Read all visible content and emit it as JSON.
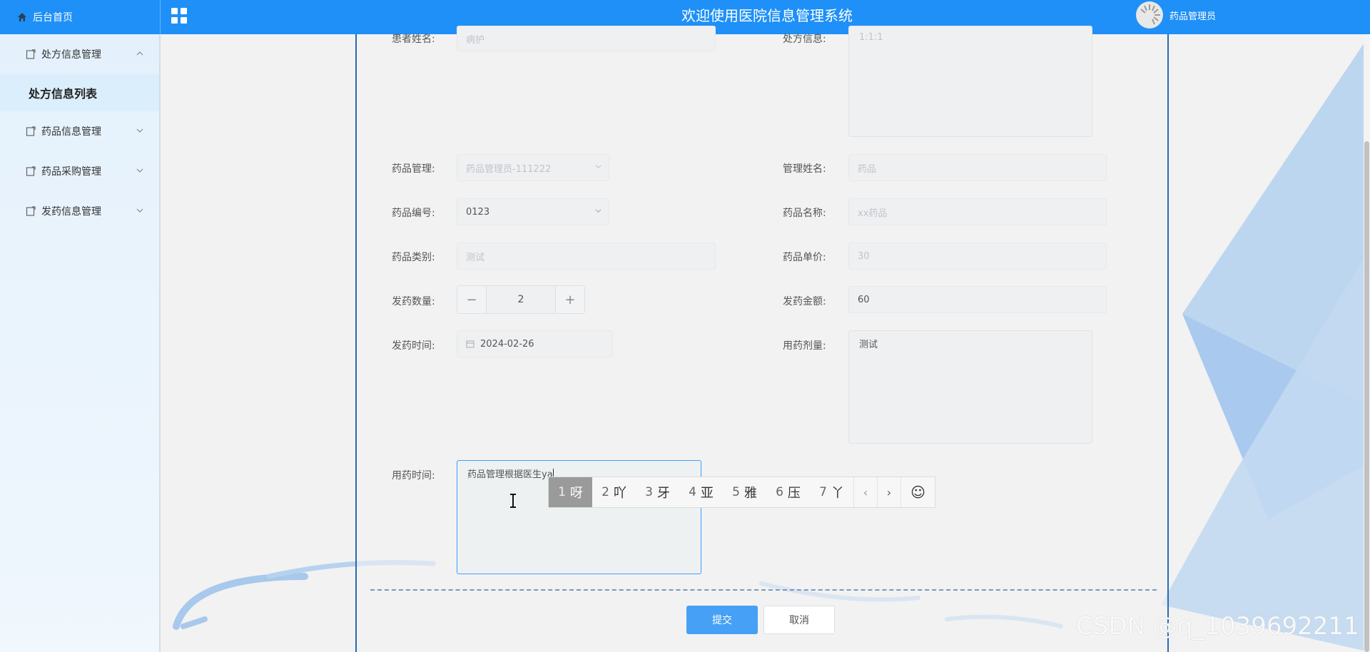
{
  "header": {
    "home_label": "后台首页",
    "title": "欢迎使用医院信息管理系统",
    "user_name": "药品管理员"
  },
  "sidebar": {
    "items": [
      {
        "label": "处方信息管理",
        "expanded": true
      },
      {
        "label": "处方信息列表",
        "sub": true
      },
      {
        "label": "药品信息管理"
      },
      {
        "label": "药品采购管理"
      },
      {
        "label": "发药信息管理"
      }
    ]
  },
  "form": {
    "patient_name": {
      "label": "患者姓名:",
      "value": "病护"
    },
    "prescription": {
      "label": "处方信息:",
      "value": "1:1:1"
    },
    "drug_admin": {
      "label": "药品管理:",
      "value": "药品管理员-111222"
    },
    "admin_name": {
      "label": "管理姓名:",
      "value": "药品"
    },
    "drug_code": {
      "label": "药品编号:",
      "value": "0123"
    },
    "drug_name": {
      "label": "药品名称:",
      "value": "xx药品"
    },
    "drug_category": {
      "label": "药品类别:",
      "value": "测试"
    },
    "unit_price": {
      "label": "药品单价:",
      "value": "30"
    },
    "quantity": {
      "label": "发药数量:",
      "value": "2",
      "minus": "−",
      "plus": "+"
    },
    "amount": {
      "label": "发药金额:",
      "value": "60"
    },
    "dispense_time": {
      "label": "发药时间:",
      "value": "2024-02-26"
    },
    "dosage": {
      "label": "用药剂量:",
      "value": "测试"
    },
    "usage_time": {
      "label": "用药时间:",
      "value": "药品管理根据医生ya"
    }
  },
  "ime": {
    "candidates": [
      {
        "n": "1",
        "c": "呀"
      },
      {
        "n": "2",
        "c": "吖"
      },
      {
        "n": "3",
        "c": "牙"
      },
      {
        "n": "4",
        "c": "亚"
      },
      {
        "n": "5",
        "c": "雅"
      },
      {
        "n": "6",
        "c": "压"
      },
      {
        "n": "7",
        "c": "丫"
      }
    ],
    "prev": "‹",
    "next": "›",
    "emoji": "☺"
  },
  "buttons": {
    "submit": "提交",
    "cancel": "取消"
  },
  "watermark": "CSDN @q_1039692211",
  "colors": {
    "topbar": "#1e90f7",
    "primary": "#46a0f5",
    "panel_border": "#2a6ab0"
  }
}
